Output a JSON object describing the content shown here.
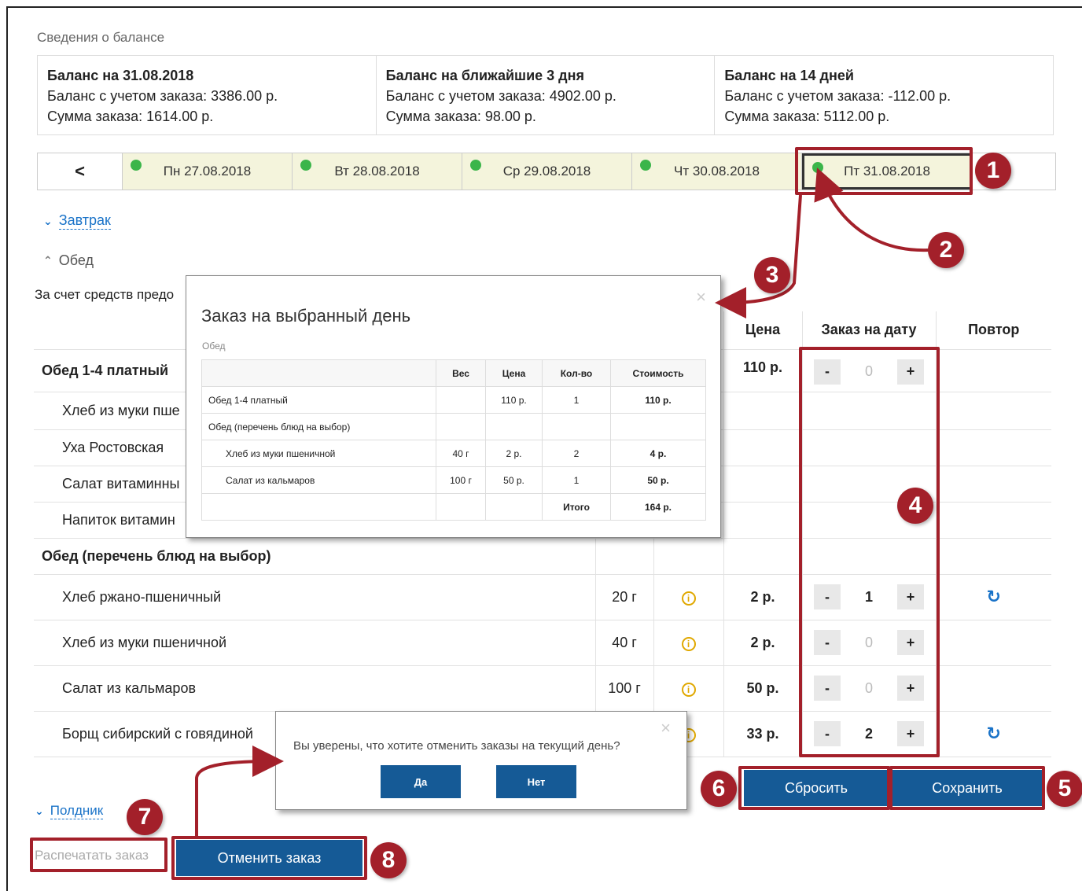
{
  "balance": {
    "caption": "Сведения о балансе",
    "columns": [
      {
        "title": "Баланс на 31.08.2018",
        "balance_line": "Баланс с учетом заказа: 3386.00 р.",
        "sum_line": "Сумма заказа: 1614.00 р."
      },
      {
        "title": "Баланс на ближайшие 3 дня",
        "balance_line": "Баланс с учетом заказа: 4902.00 р.",
        "sum_line": "Сумма заказа: 98.00 р."
      },
      {
        "title": "Баланс на 14 дней",
        "balance_line": "Баланс с учетом заказа: -112.00 р.",
        "sum_line": "Сумма заказа: 5112.00 р."
      }
    ]
  },
  "dates": {
    "prev_label": "<",
    "items": [
      {
        "label": "Пн 27.08.2018",
        "status_color": "#3bb54a"
      },
      {
        "label": "Вт 28.08.2018",
        "status_color": "#3bb54a"
      },
      {
        "label": "Ср 29.08.2018",
        "status_color": "#3bb54a"
      },
      {
        "label": "Чт 30.08.2018",
        "status_color": "#3bb54a"
      },
      {
        "label": "Пт 31.08.2018",
        "status_color": "#3bb54a"
      }
    ]
  },
  "meals": {
    "breakfast": "Завтрак",
    "lunch": "Обед",
    "snack": "Полдник"
  },
  "note": "За счет средств предо",
  "table": {
    "headers": {
      "price": "Цена",
      "order": "Заказ на дату",
      "repeat": "Повтор"
    },
    "rows": [
      {
        "name": "Обед 1-4 платный",
        "weight": "",
        "price": "110 р.",
        "qty": "0"
      },
      {
        "name": "Хлеб из муки пше",
        "weight": "",
        "price": "",
        "qty": ""
      },
      {
        "name": "Уха Ростовская",
        "weight": "",
        "price": "",
        "qty": ""
      },
      {
        "name": "Салат витаминны",
        "weight": "",
        "price": "",
        "qty": ""
      },
      {
        "name": "Напиток витамин",
        "weight": "",
        "price": "",
        "qty": ""
      },
      {
        "name": "Обед (перечень блюд на выбор)",
        "weight": "",
        "price": "",
        "qty": ""
      },
      {
        "name": "Хлеб ржано-пшеничный",
        "weight": "20 г",
        "price": "2 р.",
        "qty": "1"
      },
      {
        "name": "Хлеб из муки пшеничной",
        "weight": "40 г",
        "price": "2 р.",
        "qty": "0"
      },
      {
        "name": "Салат из кальмаров",
        "weight": "100 г",
        "price": "50 р.",
        "qty": "0"
      },
      {
        "name": "Борщ сибирский с говядиной",
        "weight": "",
        "price": "33 р.",
        "qty": "2"
      }
    ],
    "minus": "-",
    "plus": "+"
  },
  "modal": {
    "title": "Заказ на выбранный день",
    "subtitle": "Обед",
    "headers": [
      "Вес",
      "Цена",
      "Кол-во",
      "Стоимость"
    ],
    "rows": [
      {
        "name": "Обед 1-4 платный",
        "weight": "",
        "price": "110 р.",
        "qty": "1",
        "cost": "110 р."
      },
      {
        "name": "Обед (перечень блюд на выбор)",
        "weight": "",
        "price": "",
        "qty": "",
        "cost": ""
      },
      {
        "name": "Хлеб из муки пшеничной",
        "weight": "40 г",
        "price": "2 р.",
        "qty": "2",
        "cost": "4 р."
      },
      {
        "name": "Салат из кальмаров",
        "weight": "100 г",
        "price": "50 р.",
        "qty": "1",
        "cost": "50 р."
      }
    ],
    "total_label": "Итого",
    "total_value": "164 р.",
    "close": "×"
  },
  "confirm": {
    "message": "Вы уверены, что хотите отменить заказы на текущий день?",
    "yes": "Да",
    "no": "Нет",
    "close": "×"
  },
  "actions": {
    "reset": "Сбросить",
    "save": "Сохранить",
    "print": "Распечатать заказ",
    "cancel_order": "Отменить заказ"
  },
  "annotations": {
    "color": "#a3202a",
    "labels": [
      "1",
      "2",
      "3",
      "4",
      "5",
      "6",
      "7",
      "8"
    ]
  }
}
